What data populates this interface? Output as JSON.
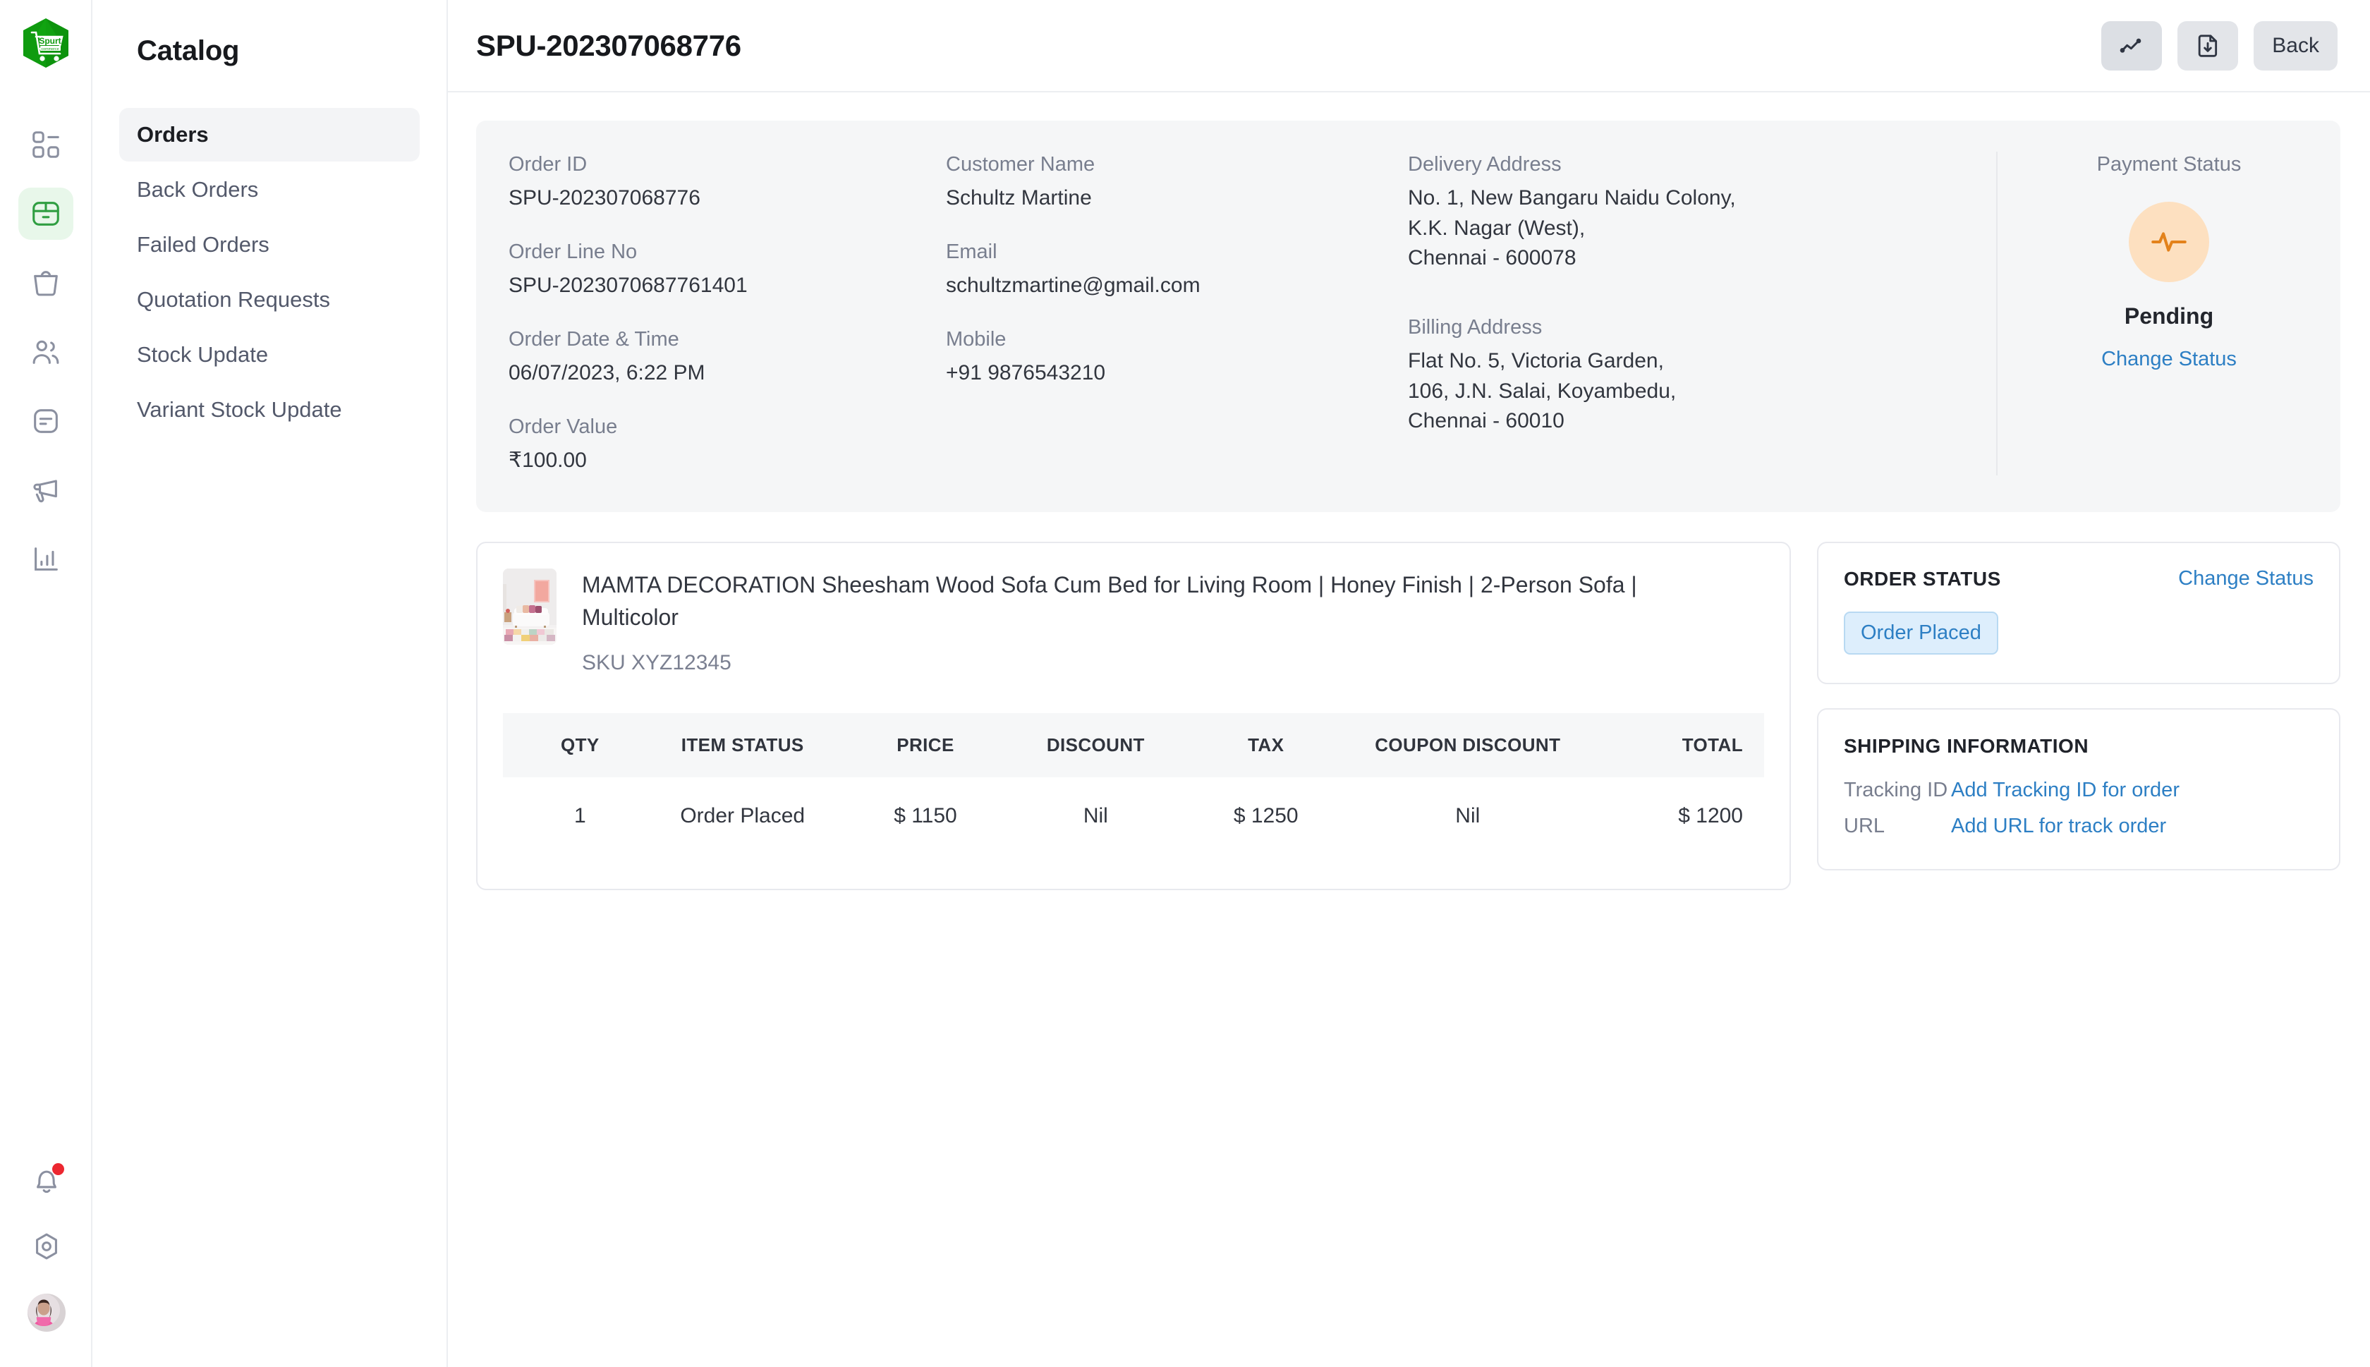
{
  "brand": {
    "name": "Spurt",
    "sub": "commerce",
    "color": "#0f9b0f"
  },
  "rail": {
    "items": [
      {
        "icon": "dashboard-icon",
        "name": "dashboard"
      },
      {
        "icon": "package-icon",
        "name": "catalog"
      },
      {
        "icon": "bag-icon",
        "name": "sales"
      },
      {
        "icon": "users-icon",
        "name": "customers"
      },
      {
        "icon": "document-icon",
        "name": "content"
      },
      {
        "icon": "megaphone-icon",
        "name": "marketing"
      },
      {
        "icon": "analytics-icon",
        "name": "reports"
      }
    ],
    "bottom": [
      {
        "icon": "bell-icon",
        "name": "notifications",
        "badge": true
      },
      {
        "icon": "gear-icon",
        "name": "settings"
      },
      {
        "icon": "avatar",
        "name": "profile"
      }
    ]
  },
  "sidebar": {
    "title": "Catalog",
    "items": [
      {
        "label": "Orders",
        "active": true
      },
      {
        "label": "Back Orders",
        "active": false
      },
      {
        "label": "Failed Orders",
        "active": false
      },
      {
        "label": "Quotation Requests",
        "active": false
      },
      {
        "label": "Stock Update",
        "active": false
      },
      {
        "label": "Variant Stock Update",
        "active": false
      }
    ]
  },
  "header": {
    "title": "SPU-202307068776",
    "actions": {
      "activity_icon": "trend-line-icon",
      "download_icon": "file-download-icon",
      "back_label": "Back"
    }
  },
  "order_info": {
    "order_id_label": "Order ID",
    "order_id": "SPU-202307068776",
    "order_line_no_label": "Order Line No",
    "order_line_no": "SPU-2023070687761401",
    "order_date_label": "Order Date & Time",
    "order_date": "06/07/2023, 6:22 PM",
    "order_value_label": "Order Value",
    "order_value": "₹100.00",
    "customer_name_label": "Customer Name",
    "customer_name": "Schultz Martine",
    "email_label": "Email",
    "email": "schultzmartine@gmail.com",
    "mobile_label": "Mobile",
    "mobile": "+91 9876543210",
    "delivery_address_label": "Delivery Address",
    "delivery_address": [
      "No. 1, New Bangaru Naidu Colony,",
      "K.K. Nagar (West),",
      "Chennai - 600078"
    ],
    "billing_address_label": "Billing Address",
    "billing_address": [
      "Flat No. 5, Victoria Garden,",
      "106, J.N. Salai, Koyambedu,",
      "Chennai - 60010"
    ],
    "payment_status_label": "Payment Status",
    "payment_status_value": "Pending",
    "payment_status_icon": "pulse-icon",
    "payment_status_color": "#e3821b",
    "payment_status_bg": "#fde0c0",
    "payment_change_status_link": "Change Status"
  },
  "product": {
    "title": "MAMTA DECORATION Sheesham Wood Sofa Cum Bed for Living Room | Honey Finish | 2-Person Sofa | Multicolor",
    "sku": "SKU XYZ12345",
    "thumbnail_alt": "living-room-sofa-photo"
  },
  "items_table": {
    "columns": [
      "QTY",
      "ITEM STATUS",
      "PRICE",
      "DISCOUNT",
      "TAX",
      "COUPON DISCOUNT",
      "TOTAL"
    ],
    "rows": [
      {
        "qty": "1",
        "item_status": "Order Placed",
        "price": "$ 1150",
        "discount": "Nil",
        "tax": "$ 1250",
        "coupon_discount": "Nil",
        "total": "$ 1200"
      }
    ]
  },
  "order_status_card": {
    "title": "ORDER STATUS",
    "change_status_link": "Change Status",
    "chip": "Order Placed"
  },
  "shipping_card": {
    "title": "SHIPPING INFORMATION",
    "tracking_id_label": "Tracking ID",
    "tracking_id_value": "Add Tracking ID for order",
    "url_label": "URL",
    "url_value": "Add URL for track order"
  }
}
